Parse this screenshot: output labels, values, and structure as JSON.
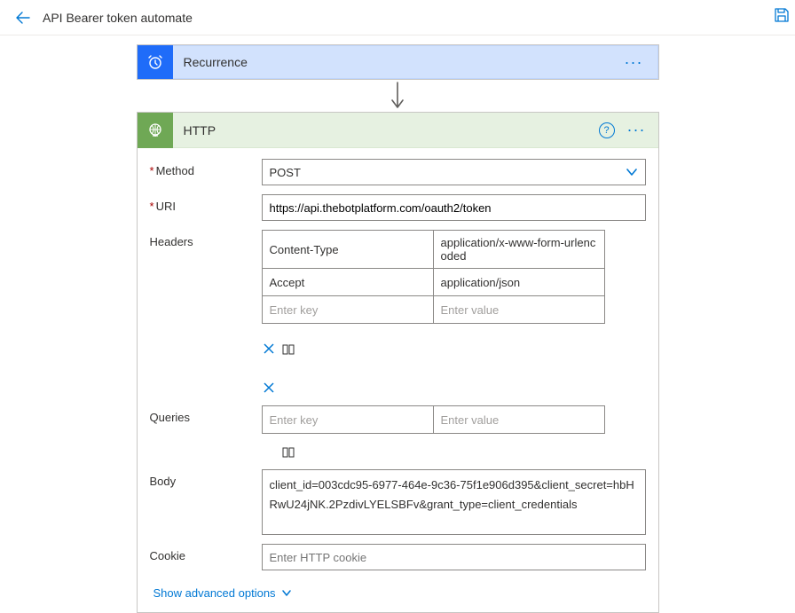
{
  "topbar": {
    "title": "API Bearer token automate"
  },
  "recurrence": {
    "title": "Recurrence"
  },
  "http": {
    "title": "HTTP",
    "labels": {
      "method": "Method",
      "uri": "URI",
      "headers": "Headers",
      "queries": "Queries",
      "body": "Body",
      "cookie": "Cookie"
    },
    "method": "POST",
    "uri": "https://api.thebotplatform.com/oauth2/token",
    "headers": [
      {
        "key": "Content-Type",
        "value": "application/x-www-form-urlencoded"
      },
      {
        "key": "Accept",
        "value": "application/json"
      }
    ],
    "headers_placeholder": {
      "key": "Enter key",
      "value": "Enter value"
    },
    "queries_placeholder": {
      "key": "Enter key",
      "value": "Enter value"
    },
    "body": "client_id=003cdc95-6977-464e-9c36-75f1e906d395&client_secret=hbHRwU24jNK.2PzdivLYELSBFv&grant_type=client_credentials",
    "cookie_placeholder": "Enter HTTP cookie",
    "advanced_link": "Show advanced options"
  }
}
